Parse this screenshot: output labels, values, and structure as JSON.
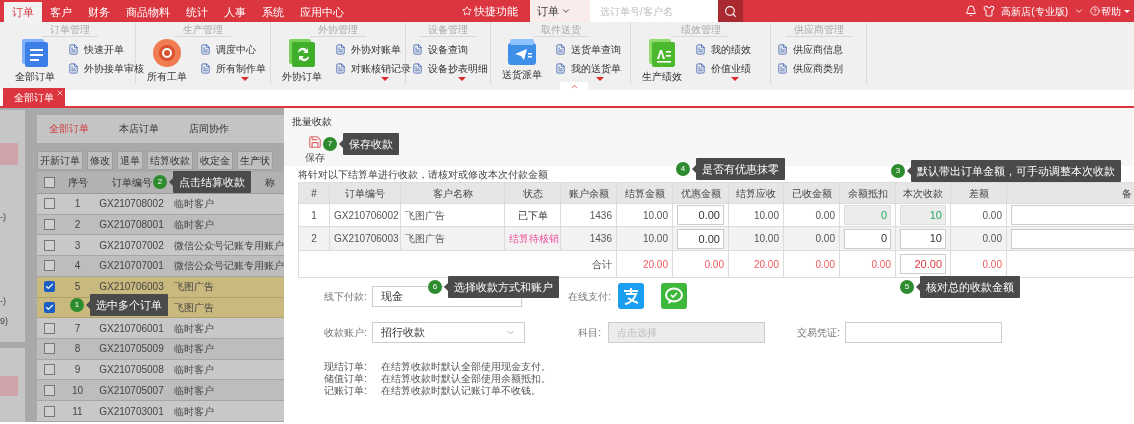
{
  "nav": {
    "menu": [
      {
        "label": "订单",
        "selected": true
      },
      {
        "label": "客户",
        "selected": false
      },
      {
        "label": "财务",
        "selected": false
      },
      {
        "label": "商品物料",
        "selected": false
      },
      {
        "label": "统计",
        "selected": false
      },
      {
        "label": "人事",
        "selected": false
      },
      {
        "label": "系统",
        "selected": false
      },
      {
        "label": "应用中心",
        "selected": false
      }
    ],
    "quick": "快捷功能",
    "search": {
      "scope": "订单",
      "placeholder": "选订单号/客户名"
    },
    "store": "高新店(专业版)",
    "help": "帮助"
  },
  "toolbar": {
    "groups": [
      {
        "title": "订单管理",
        "main": {
          "kind": "doc",
          "label": "全部订单"
        },
        "items": [
          "快速开单",
          "外协接单审核"
        ],
        "more": false
      },
      {
        "title": "生产管理",
        "main": {
          "kind": "emblem",
          "label": "所有工单"
        },
        "items": [
          "调度中心",
          "所有制作单"
        ],
        "more": true
      },
      {
        "title": "外协管理",
        "main": {
          "kind": "sync",
          "label": "外协订单"
        },
        "items": [
          "外协对账单",
          "对账核销记录"
        ],
        "more": true
      },
      {
        "title": "设备管理",
        "items": [
          "设备查询",
          "设备抄表明细"
        ],
        "more": true
      },
      {
        "title": "取件送货",
        "main": {
          "kind": "send",
          "label": "送货派单"
        },
        "items": [
          "送货单查询",
          "我的送货单"
        ],
        "more": true
      },
      {
        "title": "绩效管理",
        "main": {
          "kind": "tile",
          "label": "生产绩效"
        },
        "items": [
          "我的绩效",
          "价值业绩"
        ],
        "more": true
      },
      {
        "title": "供应商管理",
        "items": [
          "供应商信息",
          "供应商类别"
        ],
        "more": false
      }
    ]
  },
  "tabs": [
    {
      "label": "全部订单",
      "selected": true
    }
  ],
  "side": {
    "fragments": [
      "-)",
      "-)",
      "9)"
    ]
  },
  "orders": {
    "tabs": [
      {
        "label": "全部订单",
        "selected": true
      },
      {
        "label": "本店订单",
        "selected": false
      },
      {
        "label": "店间协作",
        "selected": false
      }
    ],
    "buttons": [
      "开新订单",
      "修改",
      "退单",
      "结算收款",
      "收定金",
      "生产状"
    ],
    "columns": [
      "序号",
      "订单编号",
      "称"
    ],
    "all_checked": false,
    "rows": [
      {
        "seq": "1",
        "order": "GX210708002",
        "customer": "临时客户",
        "checked": false
      },
      {
        "seq": "2",
        "order": "GX210708001",
        "customer": "临时客户",
        "checked": false
      },
      {
        "seq": "3",
        "order": "GX210707002",
        "customer": "微信公众号记账专用账户",
        "checked": false
      },
      {
        "seq": "4",
        "order": "GX210707001",
        "customer": "微信公众号记账专用账户",
        "checked": false
      },
      {
        "seq": "5",
        "order": "GX210706003",
        "customer": "飞图广告",
        "checked": true
      },
      {
        "customer": "飞图广告",
        "checked": true
      },
      {
        "seq": "7",
        "order": "GX210706001",
        "customer": "临时客户",
        "checked": false
      },
      {
        "seq": "8",
        "order": "GX210705009",
        "customer": "临时客户",
        "checked": false
      },
      {
        "seq": "9",
        "order": "GX210705008",
        "customer": "临时客户",
        "checked": false
      },
      {
        "seq": "10",
        "order": "GX210705007",
        "customer": "临时客户",
        "checked": false
      },
      {
        "seq": "11",
        "order": "GX210703001",
        "customer": "临时客户",
        "checked": false
      }
    ]
  },
  "dialog": {
    "title": "批量收款",
    "save": "保存",
    "instruction": "将针对以下结算单进行收款，请核对或修改本次付款金额",
    "columns": [
      "#",
      "订单编号",
      "客户名称",
      "状态",
      "账户余额",
      "结算金额",
      "优惠金额",
      "结算应收",
      "已收金额",
      "余额抵扣",
      "本次收款",
      "差额",
      "备"
    ],
    "rows": [
      {
        "index": "1",
        "order": "GX210706002",
        "customer": "飞图广告",
        "status": {
          "text": "已下单",
          "alert": false
        },
        "balance": "1436",
        "settle": "10.00",
        "discount": "0.00",
        "receivable": "10.00",
        "received": "0.00",
        "deduction": {
          "value": "0",
          "disabled": true
        },
        "payment": {
          "value": "10",
          "disabled": true
        },
        "difference": "0.00"
      },
      {
        "index": "2",
        "order": "GX210706003",
        "customer": "飞图广告",
        "status": {
          "text": "结算待核销",
          "alert": true
        },
        "balance": "1436",
        "settle": "10.00",
        "discount": "0.00",
        "receivable": "10.00",
        "received": "0.00",
        "deduction": {
          "value": "0",
          "disabled": false
        },
        "payment": {
          "value": "10",
          "disabled": false
        },
        "difference": "0.00"
      }
    ],
    "total": {
      "label": "合计",
      "settle": "20.00",
      "discount": "0.00",
      "receivable": "20.00",
      "received": "0.00",
      "deduction": "0.00",
      "payment": "20.00",
      "difference": "0.00"
    },
    "offline": {
      "label": "线下付款:",
      "value": "现金"
    },
    "online": {
      "label": "在线支付:"
    },
    "account": {
      "label": "收款账户:",
      "value": "招行收款"
    },
    "subject": {
      "label": "科目:",
      "placeholder": "点击选择",
      "disabled": true
    },
    "voucher": {
      "label": "交易凭证:"
    },
    "notes": [
      {
        "term": "现结订单:",
        "text": "在结算收款时默认全部使用现金支付。"
      },
      {
        "term": "储值订单:",
        "text": "在结算收款时默认全部使用余额抵扣。"
      },
      {
        "term": "记账订单:",
        "text": "在结算收款时默认记账订单不收钱。"
      }
    ]
  },
  "callouts": [
    {
      "number": "7",
      "text": "保存收款"
    },
    {
      "number": "4",
      "text": "是否有优惠抹零"
    },
    {
      "number": "3",
      "text": "默认带出订单金额，可手动调整本次收款"
    },
    {
      "number": "2",
      "text": "点击结算收款"
    },
    {
      "number": "6",
      "text": "选择收款方式和账户"
    },
    {
      "number": "5",
      "text": "核对总的收款金额"
    },
    {
      "number": "1",
      "text": "选中多个订单"
    }
  ]
}
